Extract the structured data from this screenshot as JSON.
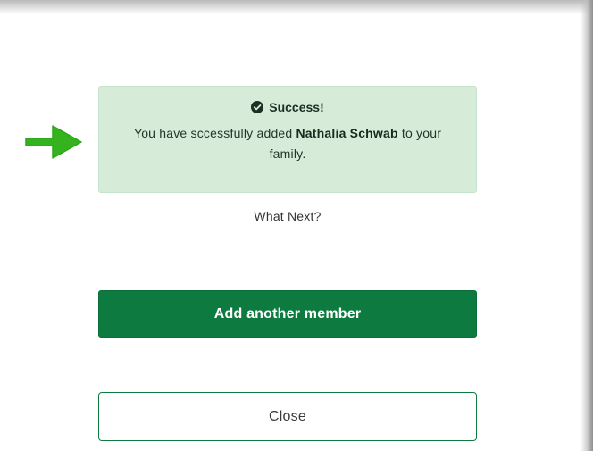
{
  "alert": {
    "title": "Success!",
    "message_prefix": "You have sccessfully added ",
    "member_name": "Nathalia Schwab",
    "message_suffix": " to your family."
  },
  "next": {
    "heading": "What Next?"
  },
  "actions": {
    "primary_label": "Add another member",
    "secondary_label": "Close"
  },
  "icons": {
    "pointer": "arrow-right-icon",
    "success": "check-circle-icon"
  },
  "colors": {
    "brand_green": "#0d7a3f",
    "success_bg": "#d6ecd9",
    "arrow_green": "#34b31f"
  }
}
